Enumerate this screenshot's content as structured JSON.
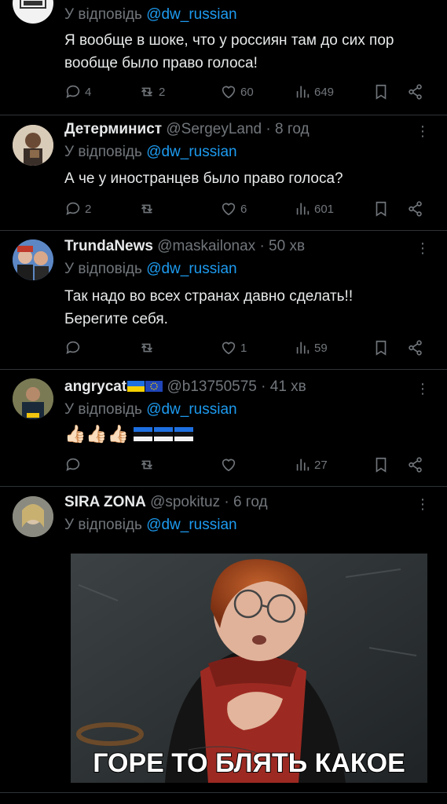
{
  "tweets": [
    {
      "name": "",
      "handle": "",
      "time": "",
      "reply_prefix": "У відповідь",
      "reply_to": "@dw_russian",
      "text": "Я вообще в шоке, что у россиян там до сих пор вообще было право голоса!",
      "replies": "4",
      "reposts": "2",
      "likes": "60",
      "views": "649"
    },
    {
      "name": "Детерминист",
      "handle": "@SergeyLand",
      "time": "· 8 год",
      "reply_prefix": "У відповідь",
      "reply_to": "@dw_russian",
      "text": "А че у иностранцев было право голоса?",
      "replies": "2",
      "reposts": "",
      "likes": "6",
      "views": "601"
    },
    {
      "name": "TrundaNews",
      "handle": "@maskailonax",
      "time": "· 50 хв",
      "reply_prefix": "У відповідь",
      "reply_to": "@dw_russian",
      "text": "Так надо во всех странах давно сделать!! Берегите себя.",
      "replies": "",
      "reposts": "",
      "likes": "1",
      "views": "59"
    },
    {
      "name": "angrycat",
      "handle": "@b13750575",
      "time": "· 41 хв",
      "reply_prefix": "У відповідь",
      "reply_to": "@dw_russian",
      "text": "👍🏻👍🏻👍🏻",
      "replies": "",
      "reposts": "",
      "likes": "",
      "views": "27"
    },
    {
      "name": "SIRA ZONA",
      "handle": "@spokituz",
      "time": "· 6 год",
      "reply_prefix": "У відповідь",
      "reply_to": "@dw_russian",
      "text": "",
      "image_caption": "ГОРЕ ТО БЛЯТЬ КАКОЕ"
    }
  ],
  "colors": {
    "background": "#000000",
    "link": "#1d9bf0",
    "muted": "#71767b",
    "text": "#e7e9ea",
    "divider": "#2f3336"
  },
  "icons": [
    "reply-icon",
    "repost-icon",
    "like-icon",
    "views-icon",
    "bookmark-icon",
    "share-icon",
    "more-icon"
  ]
}
